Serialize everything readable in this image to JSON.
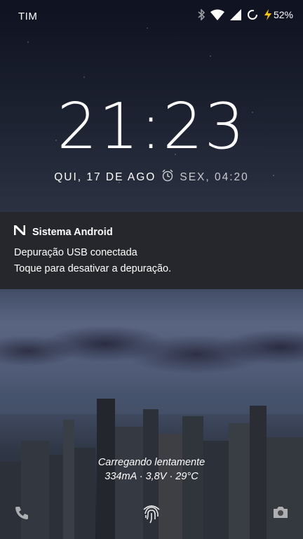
{
  "status_bar": {
    "carrier": "TIM",
    "battery_percent": "52%",
    "icons": [
      "bluetooth-icon",
      "wifi-icon",
      "signal-icon",
      "sync-icon",
      "charging-bolt-icon"
    ]
  },
  "lockscreen": {
    "time": "21:23",
    "date": "QUI, 17 DE AGO",
    "next_alarm": "SEX, 04:20"
  },
  "notification": {
    "app_name": "Sistema Android",
    "title": "Depuração USB conectada",
    "text": "Toque para desativar a depuração."
  },
  "charging": {
    "status": "Carregando lentamente",
    "details": "334mA · 3,8V · 29°C"
  },
  "colors": {
    "notification_bg": "#26272c",
    "bolt": "#f5c400"
  }
}
